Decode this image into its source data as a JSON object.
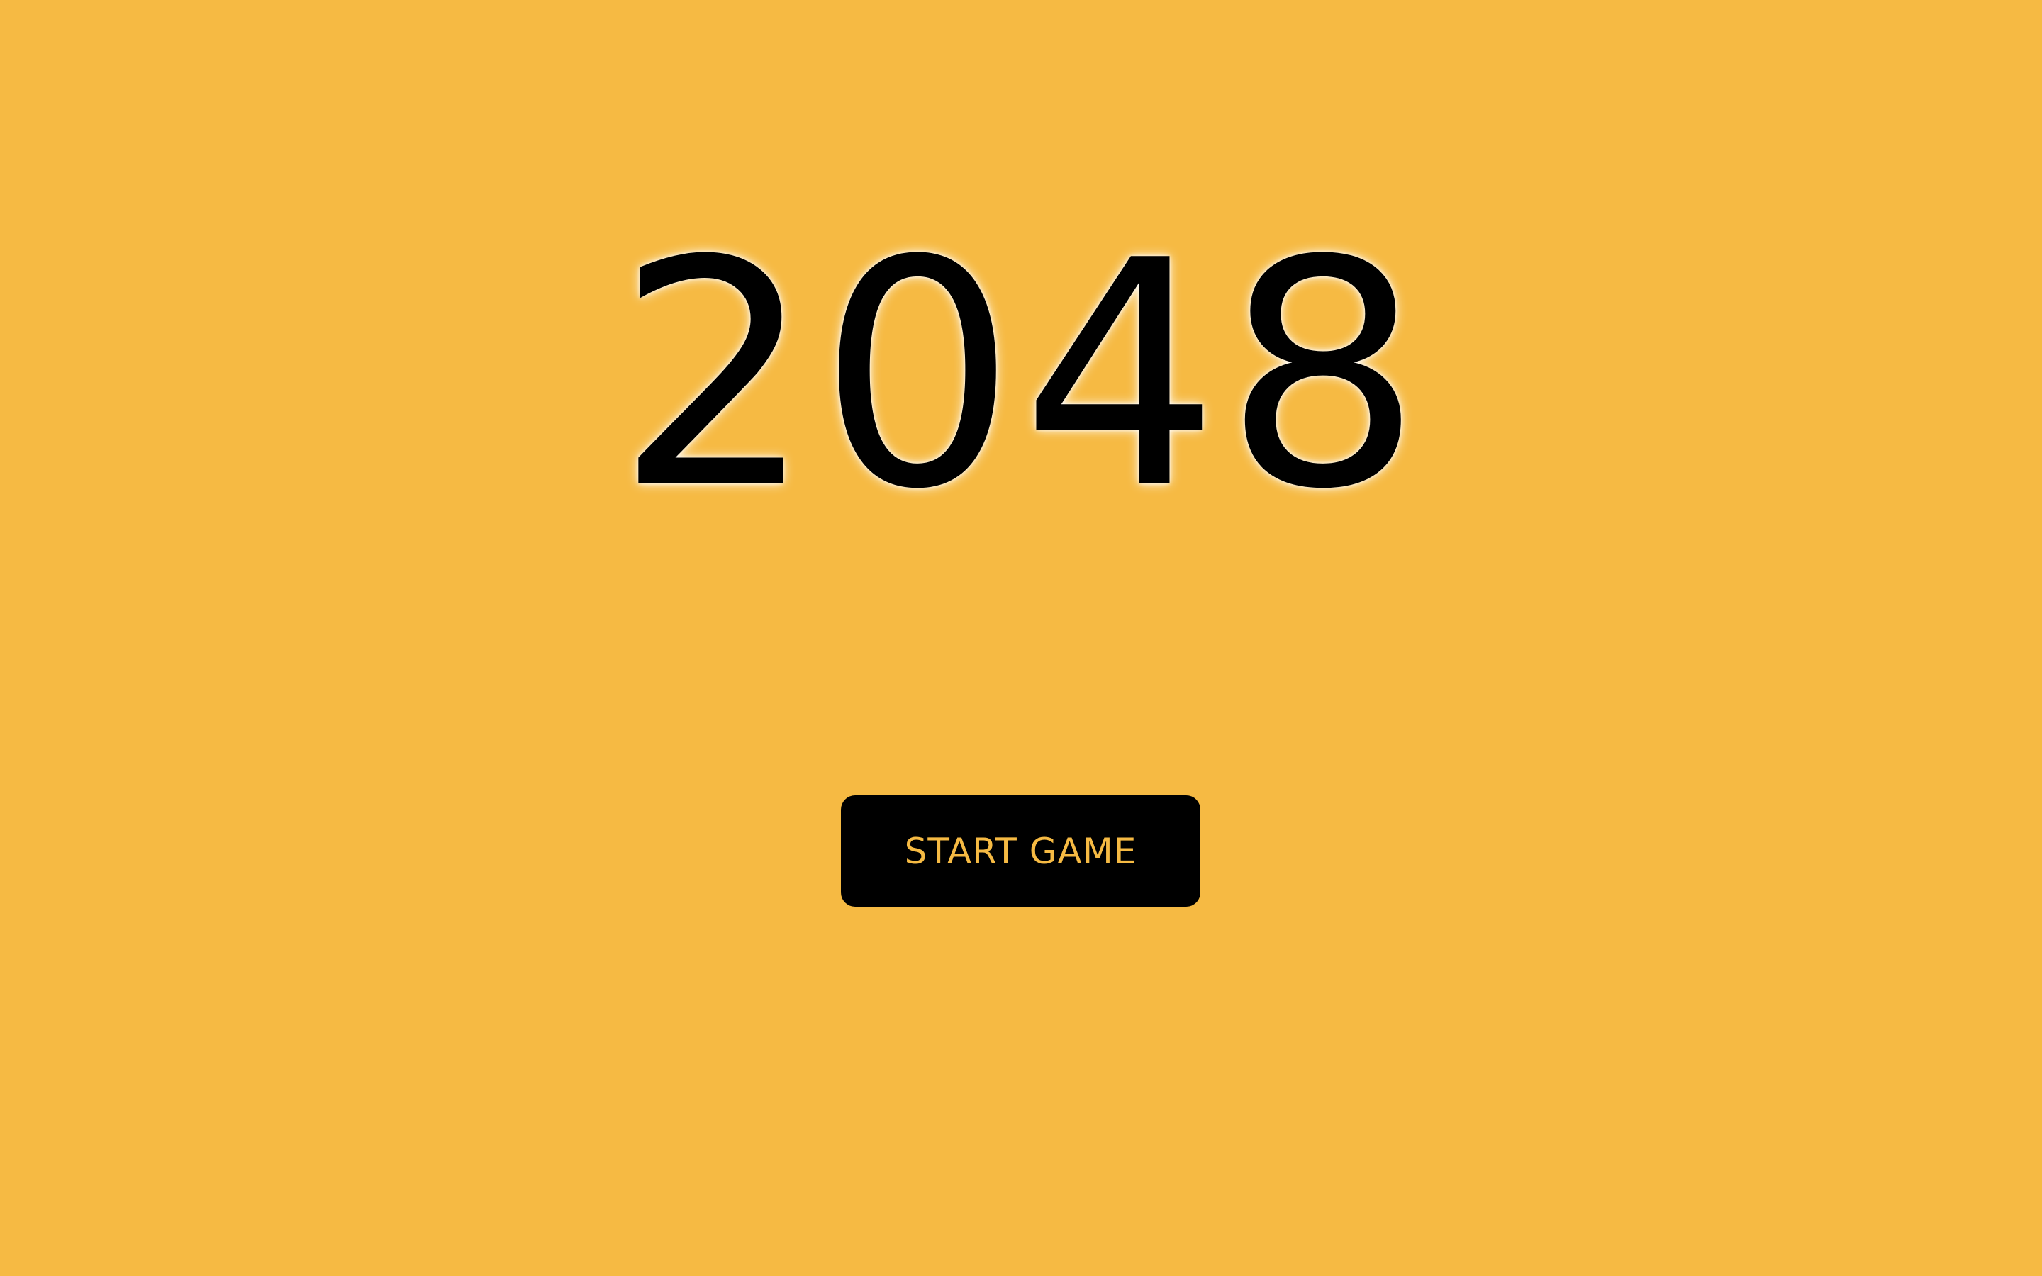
{
  "colors": {
    "background": "#F6BA43",
    "title": "#000000",
    "button_bg": "#000000",
    "button_text": "#F6BA43"
  },
  "title": "2048",
  "start_button": {
    "label": "START GAME"
  }
}
